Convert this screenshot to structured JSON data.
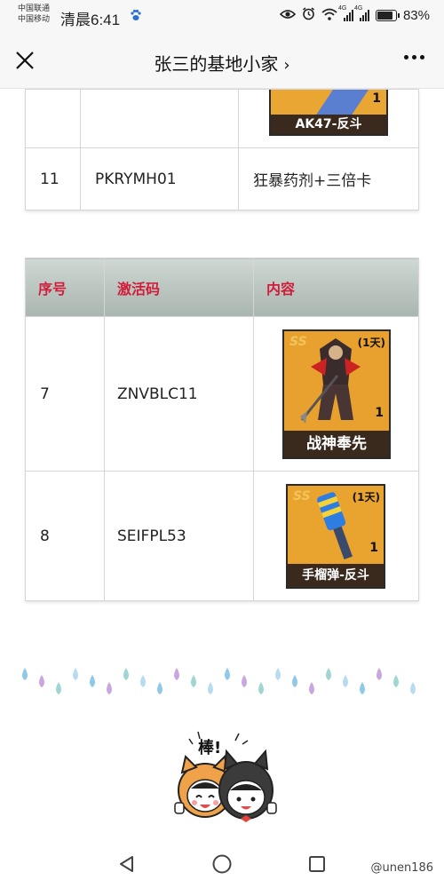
{
  "status_bar": {
    "carrier_1": "中国联通",
    "carrier_2": "中国移动",
    "time": "清晨6:41",
    "net_1": "4G",
    "net_2": "4G",
    "battery": "83%",
    "battery_level": 0.83
  },
  "title_bar": {
    "title": "张三的基地小家",
    "chevron": "›"
  },
  "table1": {
    "rows": [
      {
        "no": "",
        "code": "",
        "card_caption": "AK47-反斗",
        "card_qty": "1"
      },
      {
        "no": "11",
        "code": "PKRYMH01",
        "content": "狂暴药剂+三倍卡"
      }
    ]
  },
  "table2": {
    "headers": [
      "序号",
      "激活码",
      "内容"
    ],
    "rows": [
      {
        "no": "7",
        "code": "ZNVBLC11",
        "card_caption": "战神奉先",
        "card_tag": "(1天)",
        "card_qty": "1",
        "card_grade": "SS"
      },
      {
        "no": "8",
        "code": "SEIFPL53",
        "card_caption": "手榴弹-反斗",
        "card_tag": "(1天)",
        "card_qty": "1",
        "card_grade": "SS"
      }
    ]
  },
  "sticker": {
    "text": "棒!"
  },
  "nav": {
    "watermark": "@unen186"
  },
  "icons": [
    "close-icon",
    "more-icon",
    "back-icon",
    "home-icon",
    "recents-icon",
    "eye-icon",
    "alarm-icon",
    "wifi-icon",
    "baidu-icon"
  ]
}
